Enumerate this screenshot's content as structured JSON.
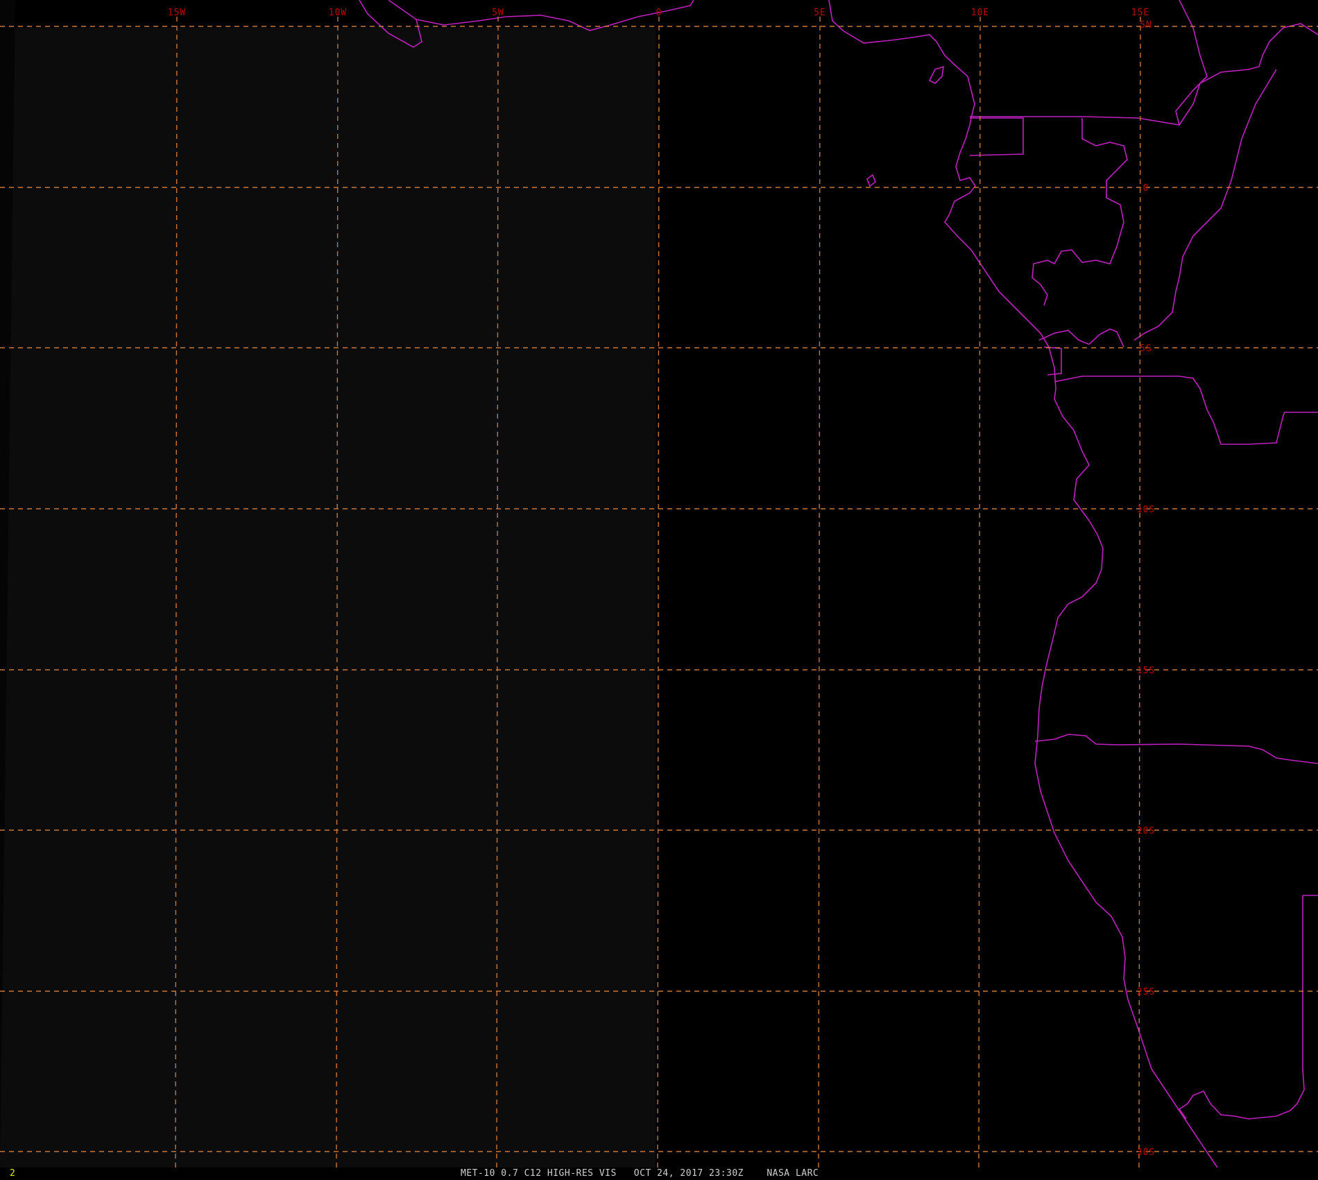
{
  "map": {
    "longitude_labels": [
      "15W",
      "10W",
      "5W",
      "0",
      "5E",
      "10E",
      "15E"
    ],
    "latitude_labels": [
      "5N",
      "0",
      "5S",
      "10S",
      "15S",
      "20S",
      "25S",
      "30S"
    ],
    "colors": {
      "background": "#000000",
      "grid": "#c87838",
      "coastline": "#c020c0",
      "labels": "#c00000",
      "west_sector_tint": "#0c0c0c"
    },
    "grid_style": "dashed",
    "overlay": "coastlines-and-borders"
  },
  "status": {
    "frame_number": "2",
    "caption": "MET-10 0.7 C12 HIGH-RES VIS   OCT 24, 2017 23:30Z    NASA LARC"
  }
}
